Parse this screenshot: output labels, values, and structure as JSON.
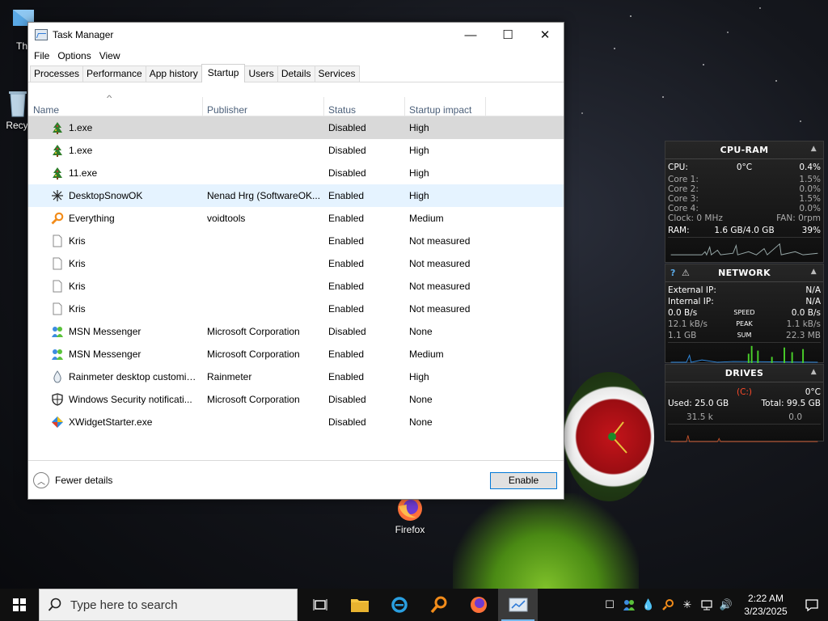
{
  "desktop": {
    "icons": [
      {
        "label": "Th"
      },
      {
        "label": "Recy"
      },
      {
        "label": "Firefox"
      }
    ]
  },
  "window": {
    "title": "Task Manager",
    "minimize": "—",
    "maximize": "☐",
    "close": "✕"
  },
  "menu": [
    "File",
    "Options",
    "View"
  ],
  "tabs": [
    "Processes",
    "Performance",
    "App history",
    "Startup",
    "Users",
    "Details",
    "Services"
  ],
  "active_tab": "Startup",
  "columns": {
    "name": "Name",
    "publisher": "Publisher",
    "status": "Status",
    "impact": "Startup impact"
  },
  "rows": [
    {
      "name": "1.exe",
      "publisher": "",
      "status": "Disabled",
      "impact": "High",
      "icon": "tree-icon"
    },
    {
      "name": "1.exe",
      "publisher": "",
      "status": "Disabled",
      "impact": "High",
      "icon": "tree-icon"
    },
    {
      "name": "11.exe",
      "publisher": "",
      "status": "Disabled",
      "impact": "High",
      "icon": "tree-icon"
    },
    {
      "name": "DesktopSnowOK",
      "publisher": "Nenad Hrg (SoftwareOK...",
      "status": "Enabled",
      "impact": "High",
      "icon": "snowflake-icon"
    },
    {
      "name": "Everything",
      "publisher": "voidtools",
      "status": "Enabled",
      "impact": "Medium",
      "icon": "magnifier-icon"
    },
    {
      "name": "Kris",
      "publisher": "",
      "status": "Enabled",
      "impact": "Not measured",
      "icon": "file-icon"
    },
    {
      "name": "Kris",
      "publisher": "",
      "status": "Enabled",
      "impact": "Not measured",
      "icon": "file-icon"
    },
    {
      "name": "Kris",
      "publisher": "",
      "status": "Enabled",
      "impact": "Not measured",
      "icon": "file-icon"
    },
    {
      "name": "Kris",
      "publisher": "",
      "status": "Enabled",
      "impact": "Not measured",
      "icon": "file-icon"
    },
    {
      "name": "MSN Messenger",
      "publisher": "Microsoft Corporation",
      "status": "Disabled",
      "impact": "None",
      "icon": "msn-icon"
    },
    {
      "name": "MSN Messenger",
      "publisher": "Microsoft Corporation",
      "status": "Enabled",
      "impact": "Medium",
      "icon": "msn-icon"
    },
    {
      "name": "Rainmeter desktop customiz...",
      "publisher": "Rainmeter",
      "status": "Enabled",
      "impact": "High",
      "icon": "droplet-icon"
    },
    {
      "name": "Windows Security notificati...",
      "publisher": "Microsoft Corporation",
      "status": "Disabled",
      "impact": "None",
      "icon": "shield-icon"
    },
    {
      "name": "XWidgetStarter.exe",
      "publisher": "",
      "status": "Disabled",
      "impact": "None",
      "icon": "xwidget-icon"
    }
  ],
  "footer": {
    "fewer_details": "Fewer details",
    "enable": "Enable"
  },
  "cpu_ram": {
    "title": "CPU-RAM",
    "cpu_label": "CPU:",
    "cpu_temp": "0°C",
    "cpu_pct": "0.4%",
    "cores": [
      {
        "label": "Core 1:",
        "val": "1.5%"
      },
      {
        "label": "Core 2:",
        "val": "0.0%"
      },
      {
        "label": "Core 3:",
        "val": "1.5%"
      },
      {
        "label": "Core 4:",
        "val": "0.0%"
      }
    ],
    "clock": "Clock: 0 MHz",
    "fan": "FAN: 0rpm",
    "ram_label": "RAM:",
    "ram_used": "1.6 GB/4.0 GB",
    "ram_pct": "39%"
  },
  "network": {
    "title": "NETWORK",
    "help": "?",
    "external_label": "External IP:",
    "external_val": "N/A",
    "internal_label": "Internal IP:",
    "internal_val": "N/A",
    "speed_label": "SPEED",
    "speed_down": "0.0 B/s",
    "speed_up": "0.0 B/s",
    "peak_label": "PEAK",
    "peak_down": "12.1 kB/s",
    "peak_up": "1.1 kB/s",
    "sum_label": "SUM",
    "sum_down": "1.1 GB",
    "sum_up": "22.3 MB"
  },
  "drives": {
    "title": "DRIVES",
    "drive": "(C:)",
    "temp": "0°C",
    "used": "Used: 25.0 GB",
    "total": "Total: 99.5 GB",
    "read": "31.5 k",
    "write": "0.0"
  },
  "taskbar": {
    "search_placeholder": "Type here to search",
    "time": "2:22 AM",
    "date": "3/23/2025"
  },
  "colors": {
    "accent": "#0078d7",
    "selected_row": "#d9d9d9",
    "hover_row": "#e5f3ff",
    "gadget_graph_green": "#4ad12a",
    "gadget_graph_blue": "#2f8ae0",
    "taskbar": "#101010"
  }
}
